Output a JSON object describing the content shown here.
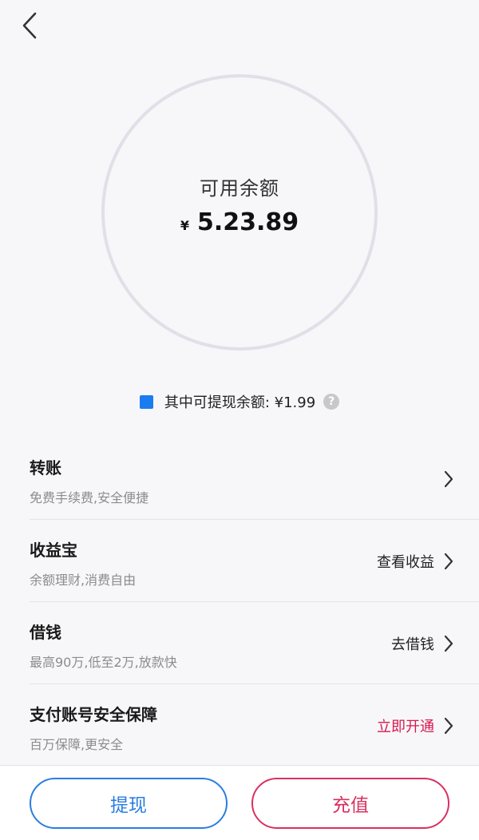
{
  "header": {
    "back_icon": "chevron-left-icon"
  },
  "balance": {
    "label": "可用余额",
    "currency_symbol": "¥",
    "amount": "5.23.89"
  },
  "withdrawable": {
    "text": "其中可提现余额: ¥1.99",
    "marker_color": "#1a7cf0",
    "help_glyph": "?"
  },
  "rows": [
    {
      "title": "转账",
      "subtitle": "免费手续费,安全便捷",
      "action": ""
    },
    {
      "title": "收益宝",
      "subtitle": "余额理财,消费自由",
      "action": "查看收益"
    },
    {
      "title": "借钱",
      "subtitle": "最高90万,低至2万,放款快",
      "action": "去借钱"
    },
    {
      "title": "支付账号安全保障",
      "subtitle": "百万保障,更安全",
      "action": "立即开通",
      "action_color": "#d9194f"
    }
  ],
  "buttons": {
    "withdraw": "提现",
    "recharge": "充值",
    "withdraw_color": "#2a7de1",
    "recharge_color": "#d93060"
  }
}
